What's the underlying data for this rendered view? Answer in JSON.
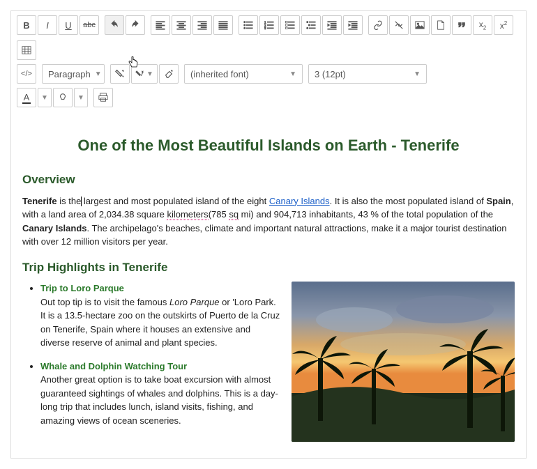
{
  "toolbar": {
    "format_style": "Paragraph",
    "font_family": "(inherited font)",
    "font_size": "3 (12pt)"
  },
  "article": {
    "title": "One of the Most Beautiful Islands on Earth - Tenerife",
    "overview_heading": "Overview",
    "p1_strong1": "Tenerife",
    "p1_t1": " is the",
    "p1_t2": " largest and most populated island of the eight ",
    "p1_link": "Canary Islands",
    "p1_t3": ". It is also the most populated island of ",
    "p1_strong2": "Spain",
    "p1_t4": ", with a land area of 2,034.38 square ",
    "p1_dotted": "kilometers",
    "p1_t5": "(785 ",
    "p1_dotted2": "sq",
    "p1_t6": " mi) and 904,713 inhabitants, 43 % of the total population of the ",
    "p1_strong3": "Canary Islands",
    "p1_t7": ". The archipelago's beaches, climate and important natural attractions, make it a major tourist destination with over 12 million visitors per year.",
    "highlights_heading": "Trip Highlights in Tenerife",
    "hl1_title": "Trip to Loro Parque",
    "hl1_a": "Out top tip is to visit the famous ",
    "hl1_em": "Loro Parque",
    "hl1_b": " or 'Loro Park. It is a 13.5-hectare zoo on the outskirts of Puerto de la Cruz on Tenerife, Spain where it houses an extensive and diverse reserve of animal and plant species.",
    "hl2_title": "Whale and Dolphin Watching Tour",
    "hl2_body": "Another great option is to take boat excursion with almost guaranteed sightings of whales and dolphins. This is a day-long trip that includes lunch, island visits, fishing, and amazing views of ocean sceneries."
  }
}
